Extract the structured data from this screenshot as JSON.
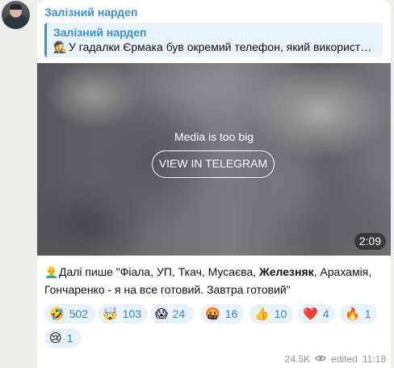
{
  "sender": {
    "name": "Залізний нардеп"
  },
  "reply": {
    "title": "Залізний нардеп",
    "emoji": "🕵",
    "text": "У гадалки Єрмака був окремий телефон, який використ…"
  },
  "media": {
    "notice": "Media is too big",
    "button_label": "VIEW IN TELEGRAM",
    "duration": "2:09"
  },
  "caption": {
    "emoji": "👨‍🦲",
    "text_before": "Далі пише \"Фіала, УП, Ткач, Мусаєва, ",
    "bold": "Железняк",
    "text_after": ", Арахамія, Гончаренко - я на все готовий. Завтра готовий\""
  },
  "reactions": [
    {
      "emoji": "🤣",
      "icon": "rofl-icon",
      "count": "502"
    },
    {
      "emoji": "🤯",
      "icon": "exploding-head-icon",
      "count": "103"
    },
    {
      "emoji": "😱",
      "icon": "scream-icon",
      "count": "24"
    },
    {
      "emoji": "🤬",
      "icon": "cursing-face-icon",
      "count": "16"
    },
    {
      "emoji": "👍",
      "icon": "thumbs-up-icon",
      "count": "10"
    },
    {
      "emoji": "❤️",
      "icon": "red-heart-icon",
      "count": "4"
    },
    {
      "emoji": "🔥",
      "icon": "fire-icon",
      "count": "1"
    },
    {
      "emoji": "😢",
      "icon": "crying-face-icon",
      "count": "1"
    }
  ],
  "footer": {
    "views": "24.5K",
    "edited": "edited",
    "time": "11:18"
  },
  "colors": {
    "accent": "#3a8fd6",
    "reaction_bg": "#e8f2fb",
    "meta": "#8d959c"
  }
}
